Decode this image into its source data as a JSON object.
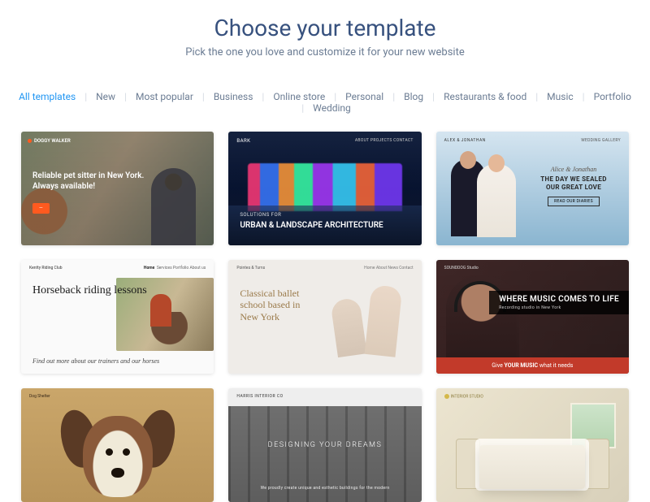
{
  "header": {
    "title": "Choose your template",
    "subtitle": "Pick the one you love and customize it for your new website"
  },
  "filters": [
    {
      "label": "All templates",
      "active": true
    },
    {
      "label": "New"
    },
    {
      "label": "Most popular"
    },
    {
      "label": "Business"
    },
    {
      "label": "Online store"
    },
    {
      "label": "Personal"
    },
    {
      "label": "Blog"
    },
    {
      "label": "Restaurants & food"
    },
    {
      "label": "Music"
    },
    {
      "label": "Portfolio"
    },
    {
      "label": "Wedding"
    }
  ],
  "templates": [
    {
      "brand": "DOGGY WALKER",
      "headline": "Reliable pet sitter in New York. Always available!",
      "cta": "—"
    },
    {
      "brand": "BARK",
      "nav": "ABOUT   PROJECTS   CONTACT",
      "pre": "SOLUTIONS FOR",
      "headline": "URBAN & LANDSCAPE ARCHITECTURE"
    },
    {
      "brand": "ALEX & JONATHAN",
      "nav": "WEDDING   GALLERY",
      "script": "Alice & Jonathan",
      "headline": "THE DAY WE SEALED OUR GREAT LOVE",
      "cta": "READ OUR DIARIES"
    },
    {
      "brand": "Kentty Riding Club",
      "nav_active": "Home",
      "nav_rest": "Services   Portfolio   About us",
      "headline": "Horseback riding lessons",
      "sub": "Find out more about our trainers and our horses"
    },
    {
      "brand": "Pointes & Turns",
      "nav": "Home   About   News   Contact",
      "headline": "Classical ballet school based in New York"
    },
    {
      "brand": "SOUNDDOG Studio",
      "headline": "WHERE MUSIC COMES TO LIFE",
      "sub": "Recording studio in New York",
      "bar_pre": "Give ",
      "bar_bold": "YOUR MUSIC",
      "bar_post": " what it needs"
    },
    {
      "brand": "Dog Shelter"
    },
    {
      "brand": "HARRIS INTERIOR CO",
      "headline": "DESIGNING YOUR DREAMS",
      "sub": "We proudly create unique and esthetic buildings for the modern"
    },
    {
      "brand": "INTERIOR STUDIO"
    }
  ]
}
